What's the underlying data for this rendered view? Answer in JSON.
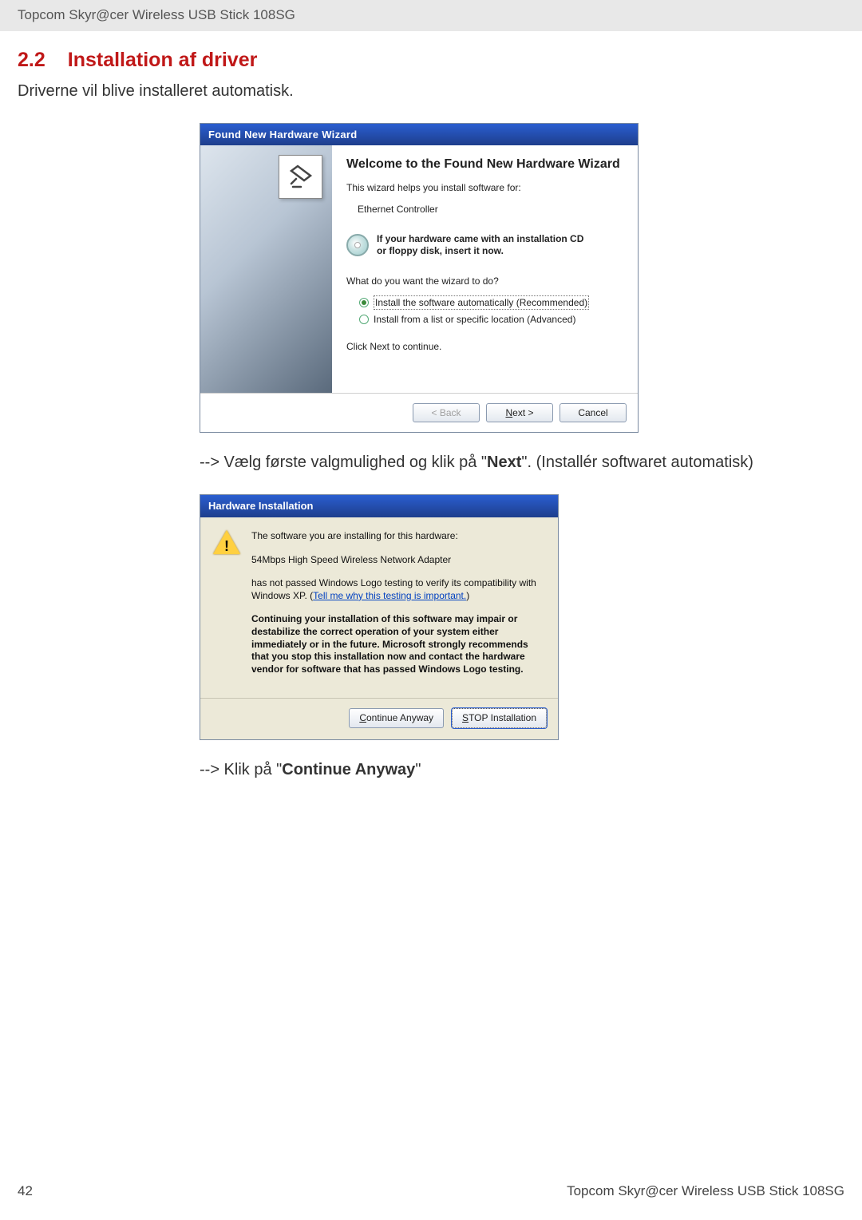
{
  "header_product": "Topcom Skyr@cer Wireless USB Stick 108SG",
  "section": {
    "num": "2.2",
    "title": "Installation af driver"
  },
  "intro": "Driverne vil blive installeret automatisk.",
  "wiz": {
    "title": "Found New Hardware Wizard",
    "heading": "Welcome to the Found New Hardware Wizard",
    "helps": "This wizard helps you install software for:",
    "device": "Ethernet Controller",
    "cd_line1": "If your hardware came with an installation CD",
    "cd_line2": "or floppy disk, insert it now.",
    "question": "What do you want the wizard to do?",
    "opt1": "Install the software automatically (Recommended)",
    "opt2": "Install from a list or specific location (Advanced)",
    "click_next": "Click Next to continue.",
    "back": "< Back",
    "next": "Next >",
    "cancel": "Cancel"
  },
  "instr1_pre": "--> Vælg første valgmulighed og klik på \"",
  "instr1_bold": "Next",
  "instr1_post": "\".  (Installér softwaret automatisk)",
  "dlg2": {
    "title": "Hardware Installation",
    "l1": "The software you are installing for this hardware:",
    "l2": "54Mbps High Speed Wireless Network Adapter",
    "l3a": "has not passed Windows Logo testing to verify its compatibility with Windows XP. (",
    "l3link": "Tell me why this testing is important.",
    "l3b": ")",
    "bold": "Continuing your installation of this software may impair or destabilize the correct operation of your system either immediately or in the future. Microsoft strongly recommends that you stop this installation now and contact the hardware vendor for software that has passed Windows Logo testing.",
    "continue": "Continue Anyway",
    "stop": "STOP Installation"
  },
  "instr2_pre": "--> Klik på \"",
  "instr2_bold": "Continue Anyway",
  "instr2_post": "\"",
  "footer": {
    "page": "42",
    "product": "Topcom Skyr@cer Wireless USB Stick 108SG"
  }
}
